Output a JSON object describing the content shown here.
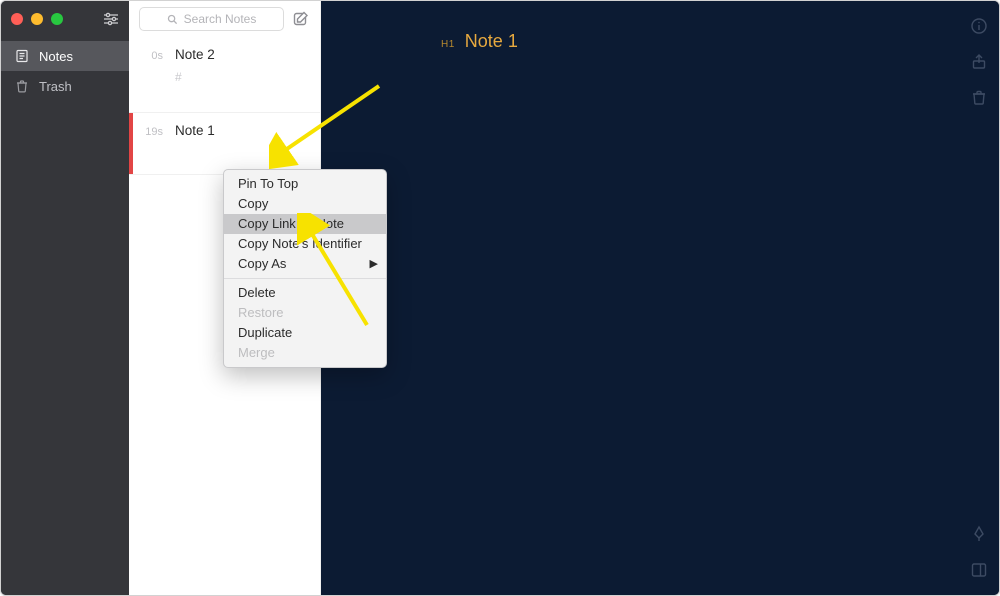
{
  "sidebar": {
    "items": [
      {
        "label": "Notes"
      },
      {
        "label": "Trash"
      }
    ]
  },
  "search": {
    "placeholder": "Search Notes"
  },
  "notes": [
    {
      "time": "0s",
      "title": "Note 2",
      "subtitle": "#"
    },
    {
      "time": "19s",
      "title": "Note 1",
      "subtitle": ""
    }
  ],
  "editor": {
    "heading_tag": "H1",
    "title": "Note 1"
  },
  "context_menu": {
    "items": [
      {
        "label": "Pin To Top"
      },
      {
        "label": "Copy"
      },
      {
        "label": "Copy Link To Note"
      },
      {
        "label": "Copy Note's Identifier"
      },
      {
        "label": "Copy As"
      }
    ],
    "items2": [
      {
        "label": "Delete"
      },
      {
        "label": "Restore"
      },
      {
        "label": "Duplicate"
      },
      {
        "label": "Merge"
      }
    ]
  }
}
